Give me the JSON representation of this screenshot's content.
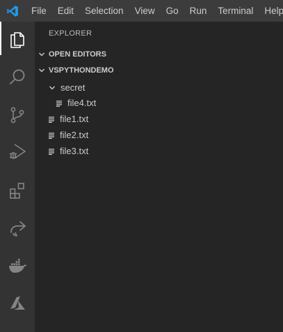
{
  "menubar": {
    "items": [
      {
        "id": "file",
        "label": "File"
      },
      {
        "id": "edit",
        "label": "Edit"
      },
      {
        "id": "selection",
        "label": "Selection"
      },
      {
        "id": "view",
        "label": "View"
      },
      {
        "id": "go",
        "label": "Go"
      },
      {
        "id": "run",
        "label": "Run"
      },
      {
        "id": "terminal",
        "label": "Terminal"
      },
      {
        "id": "help",
        "label": "Help"
      }
    ],
    "logo_icon": "vscode-logo-icon",
    "logo_color": "#1f9cf0"
  },
  "activitybar": {
    "items": [
      {
        "id": "explorer",
        "icon": "files-icon",
        "active": true
      },
      {
        "id": "search",
        "icon": "search-icon",
        "active": false
      },
      {
        "id": "source-control",
        "icon": "source-control-icon",
        "active": false
      },
      {
        "id": "run-debug",
        "icon": "run-debug-icon",
        "active": false
      },
      {
        "id": "extensions",
        "icon": "extensions-icon",
        "active": false
      },
      {
        "id": "live-share",
        "icon": "live-share-icon",
        "active": false
      },
      {
        "id": "docker",
        "icon": "docker-icon",
        "active": false
      },
      {
        "id": "azure",
        "icon": "azure-icon",
        "active": false
      }
    ]
  },
  "sidebar": {
    "title": "EXPLORER",
    "sections": {
      "open_editors": {
        "label": "OPEN EDITORS",
        "expanded": false
      },
      "workspace": {
        "label": "VSPYTHONDEMO",
        "expanded": true
      }
    },
    "tree": {
      "folder": {
        "label": "secret",
        "expanded": true
      },
      "folder_files": [
        {
          "label": "file4.txt",
          "icon": "text-file-icon"
        }
      ],
      "root_files": [
        {
          "label": "file1.txt",
          "icon": "text-file-icon"
        },
        {
          "label": "file2.txt",
          "icon": "text-file-icon"
        },
        {
          "label": "file3.txt",
          "icon": "text-file-icon"
        }
      ]
    }
  },
  "colors": {
    "titlebar_bg": "#3c3c3c",
    "activitybar_bg": "#333333",
    "sidebar_bg": "#252526",
    "text": "#cccccc",
    "icon_inactive": "#858585",
    "icon_active": "#ffffff"
  }
}
